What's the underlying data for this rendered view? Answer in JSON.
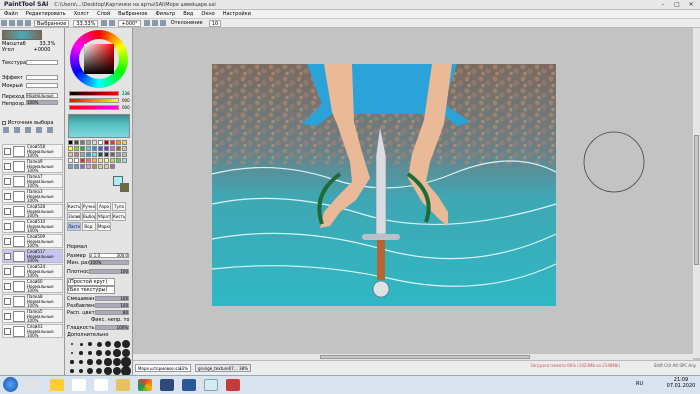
{
  "app": {
    "logo": "PaintTool SAI",
    "path": "C:\\Users\\...\\Desktop\\Картинки на арты\\SAI\\Море швейцаре.sai",
    "win_buttons": [
      "–",
      "□",
      "✕"
    ]
  },
  "menu": [
    "Файл",
    "Редактировать",
    "Холст",
    "Слой",
    "Выбранное",
    "Фильтр",
    "Вид",
    "Окно",
    "Настройки"
  ],
  "toolbar": {
    "selected_label": "Выбранное",
    "zoom": "33.33%",
    "angle": "+000°",
    "stabilizer_label": "Отклонение",
    "stabilizer_value": "10"
  },
  "left": {
    "nav_zoom_label": "Масштаб",
    "nav_zoom": "33.3%",
    "nav_angle_label": "Угол",
    "nav_angle": "+0000",
    "texture_label": "Текстура",
    "effect_label": "Эффект",
    "effect2_label": "Мокрый",
    "mode_label": "Переход",
    "mode_value": "Нормальные",
    "opacity_label": "Непрозр.",
    "opacity": "100%",
    "pin_label": "Источник выбора",
    "layers": [
      {
        "name": "Слой558\nНормальные\n100%"
      },
      {
        "name": "Папка9\nНормальные\n100%"
      },
      {
        "name": "Папка7\nНормальные\n100%"
      },
      {
        "name": "Папка3\nНормальные\n100%"
      },
      {
        "name": "Слой528\nНормальные\n100%"
      },
      {
        "name": "Слой510\nНормальные\n100%"
      },
      {
        "name": "Слой509\nНормальные\n100%"
      },
      {
        "name": "Слой517\nНормальные\n100%"
      },
      {
        "name": "Слой524\nНормальные\n100%"
      },
      {
        "name": "Слой60\nНормальные\n100%"
      },
      {
        "name": "Папка8\nНормальные\n100%"
      },
      {
        "name": "Папка5\nНормальные\n100%"
      },
      {
        "name": "Слой43\nНормальные\n100%"
      }
    ]
  },
  "mid": {
    "rgb_values": [
      "238",
      "000",
      "000"
    ],
    "tools": [
      "Кисть",
      "Ручка",
      "Аэро",
      "Тупа",
      "Заливка",
      "Выбор",
      "Убрать",
      "Кисть",
      "Ластик",
      "Вод.",
      "Маркер"
    ],
    "brush_mode": "Нормал",
    "size_label": "Размер",
    "size_mult": "x 1.0",
    "size_value": "300.0",
    "min_size_label": "Мин. размер",
    "min_size": "100%",
    "density_label": "Плотность",
    "density": "100",
    "shape_label": "(Простой круг)",
    "texture_label": "(Без текстуры)",
    "blend_label": "Смешивание цв.",
    "blend": "100",
    "dilution_label": "Разбавление",
    "dilution": "100",
    "persist_label": "Расп. цвета",
    "persist": "80",
    "keep_opacity": "Фикс. непр. то",
    "smooth_label": "Гладкость",
    "smooth": "100%",
    "extra_label": "Дополнительно",
    "brush_sizes": [
      "0.7",
      "1",
      "1.5",
      "2",
      "2.3",
      "2.6",
      "3",
      "3.5",
      "4",
      "5",
      "6",
      "7",
      "8",
      "9",
      "10",
      "12",
      "14",
      "16",
      "20",
      "25",
      "30",
      "35",
      "40",
      "50",
      "60",
      "70",
      "80",
      "100",
      "120",
      "160",
      "200",
      "250",
      "300",
      "350",
      "400",
      "450",
      "500"
    ]
  },
  "status": {
    "file1": "Море штормовое.sai",
    "file1_zoom": "33%",
    "file2": "grunge_texture07...",
    "file2_zoom": "38%",
    "memory": "Загрузка памяти 66% (1423Mb из 2148Mb)",
    "caps": "Shift Ctrl Alt SPC Any"
  },
  "taskbar": {
    "lang": "RU",
    "time": "21:09",
    "date": "07.01.2020"
  },
  "colors": {
    "canvas_bg": "#c3c3c3",
    "selected_layer": "#c8c4f0",
    "ui_bg": "#e9e9e9",
    "taskbar": "#d9e3ef"
  }
}
